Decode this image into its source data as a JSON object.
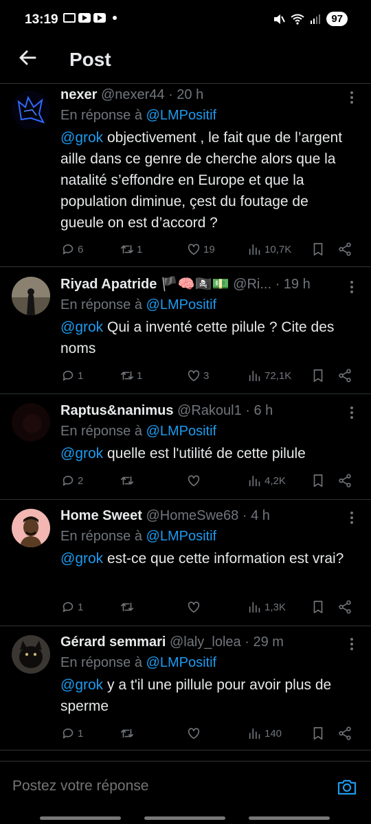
{
  "status_bar": {
    "time": "13:19",
    "battery": "97",
    "app_icons": [
      "gmail-icon",
      "youtube-icon",
      "youtube-icon"
    ]
  },
  "header": {
    "title": "Post"
  },
  "colors": {
    "background": "#000000",
    "text": "#e7e9ea",
    "secondary": "#71767b",
    "accent": "#1d9bf0",
    "divider": "#2f3336"
  },
  "replies": [
    {
      "name": "nexer",
      "handle": "@nexer44",
      "time": "· 20 h",
      "replying_prefix": "En réponse à",
      "replying_to": "@LMPositif",
      "mention": "@grok",
      "text": " objectivement , le fait que de l’argent aille dans ce genre de cherche alors que la natalité s’effondre en Europe et que la population diminue, çest du foutage de gueule on est d’accord ?",
      "replies": "6",
      "reposts": "1",
      "likes": "19",
      "views": "10,7K"
    },
    {
      "name": "Riyad Apatride 🏴🧠🏴‍☠️💵",
      "handle": "@Ri...",
      "time": "· 19 h",
      "replying_prefix": "En réponse à",
      "replying_to": "@LMPositif",
      "mention": "@grok",
      "text": " Qui a inventé cette pilule ? Cite des noms",
      "replies": "1",
      "reposts": "1",
      "likes": "3",
      "views": "72,1K"
    },
    {
      "name": "Raptus&nanimus",
      "handle": "@Rakoul1",
      "time": "· 6 h",
      "replying_prefix": "En réponse à",
      "replying_to": "@LMPositif",
      "mention": "@grok",
      "text": " quelle est l'utilité de cette pilule",
      "replies": "2",
      "reposts": "",
      "likes": "",
      "views": "4,2K"
    },
    {
      "name": "Home Sweet",
      "handle": "@HomeSwe68",
      "time": "· 4 h",
      "replying_prefix": "En réponse à",
      "replying_to": "@LMPositif",
      "mention": "@grok",
      "text": " est-ce que cette information est vrai?",
      "replies": "1",
      "reposts": "",
      "likes": "",
      "views": "1,3K"
    },
    {
      "name": "Gérard semmari",
      "handle": "@laly_lolea",
      "time": "· 29 m",
      "replying_prefix": "En réponse à",
      "replying_to": "@LMPositif",
      "mention": "@grok",
      "text": " y a t'il une pillule pour avoir plus de sperme",
      "replies": "1",
      "reposts": "",
      "likes": "",
      "views": "140"
    }
  ],
  "compose": {
    "placeholder": "Postez votre réponse"
  }
}
